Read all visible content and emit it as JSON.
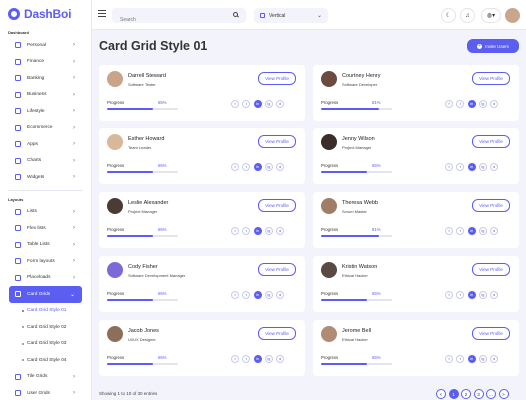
{
  "app": {
    "logo_text": "DashBoi"
  },
  "sidebar": {
    "dashboard_title": "Dashboard",
    "dashboard_items": [
      {
        "label": "Personal"
      },
      {
        "label": "Finance"
      },
      {
        "label": "Banking"
      },
      {
        "label": "Business"
      },
      {
        "label": "Lifestyle"
      },
      {
        "label": "Ecommerce"
      },
      {
        "label": "Apps"
      },
      {
        "label": "Charts"
      },
      {
        "label": "Widgets"
      }
    ],
    "layouts_title": "Layouts",
    "layout_items": [
      {
        "label": "Lists"
      },
      {
        "label": "Flex lists"
      },
      {
        "label": "Table Lists"
      },
      {
        "label": "Form layouts"
      },
      {
        "label": "Placeloads"
      }
    ],
    "active_item": {
      "label": "Card Grids"
    },
    "sub_items": [
      {
        "label": "Card Grid Style 01",
        "active": true
      },
      {
        "label": "Card Grid Style 02"
      },
      {
        "label": "Card Grid Style 03"
      },
      {
        "label": "Card Grid Style 04"
      }
    ],
    "bottom_items": [
      {
        "label": "Tile Grids"
      },
      {
        "label": "User Grids"
      }
    ]
  },
  "topbar": {
    "search_placeholder": "Search",
    "layout_select": "Vertical"
  },
  "page": {
    "title": "Card Grid Style 01",
    "invite_label": "Invite Users",
    "view_label": "View Profile",
    "progress_label": "Progress",
    "social_icons": [
      "f",
      "t",
      "in",
      "ig",
      "d"
    ],
    "footer_text": "Showing 1 to 10 of 30 entries",
    "pages": [
      "<",
      "1",
      "2",
      "3",
      "...",
      ">"
    ]
  },
  "colors": {
    "accent": "#5b5ef0"
  },
  "cards": [
    {
      "name": "Darrell Steward",
      "role": "Software Tester",
      "progress": "65%",
      "progress_value": 0.65,
      "avatar_color": "#c9a48a"
    },
    {
      "name": "Courtney Henry",
      "role": "Software Developer",
      "progress": "81%",
      "progress_value": 0.81,
      "avatar_color": "#6b4b3e"
    },
    {
      "name": "Esther Howard",
      "role": "Team Leader",
      "progress": "65%",
      "progress_value": 0.65,
      "avatar_color": "#d9b79a"
    },
    {
      "name": "Jenny Wilson",
      "role": "Project Manager",
      "progress": "65%",
      "progress_value": 0.65,
      "avatar_color": "#3a2d2a"
    },
    {
      "name": "Leslie Alexander",
      "role": "Project Manager",
      "progress": "65%",
      "progress_value": 0.65,
      "avatar_color": "#4a3b34"
    },
    {
      "name": "Theresa Webb",
      "role": "Scrum Master",
      "progress": "81%",
      "progress_value": 0.81,
      "avatar_color": "#a07d66"
    },
    {
      "name": "Cody Fisher",
      "role": "Software Development Manager",
      "progress": "65%",
      "progress_value": 0.65,
      "avatar_color": "#7b6bd6"
    },
    {
      "name": "Kristin Watson",
      "role": "Ethical Hacker",
      "progress": "65%",
      "progress_value": 0.65,
      "avatar_color": "#5a4a44"
    },
    {
      "name": "Jacob Jones",
      "role": "UI/UX Designer",
      "progress": "65%",
      "progress_value": 0.65,
      "avatar_color": "#8d6e5a"
    },
    {
      "name": "Jerome Bell",
      "role": "Ethical Hacker",
      "progress": "65%",
      "progress_value": 0.65,
      "avatar_color": "#b08c74"
    }
  ]
}
